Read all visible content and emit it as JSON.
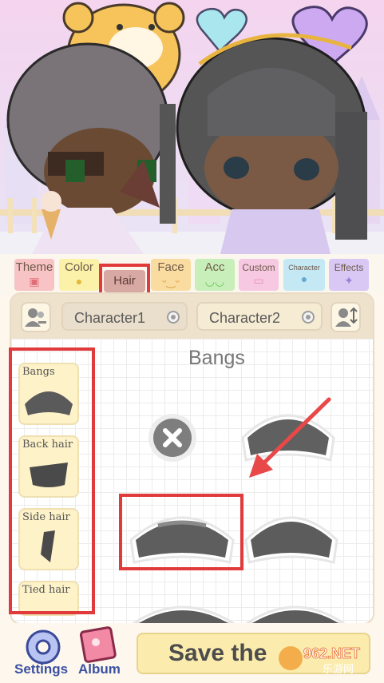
{
  "tabs": [
    {
      "label": "Theme",
      "icon": "scene-icon",
      "color": "#f7c3c4"
    },
    {
      "label": "Color",
      "icon": "drop-icon",
      "color": "#fbf1a8"
    },
    {
      "label": "Hair",
      "icon": "hair-icon",
      "color": "#d8a9a2",
      "selected": true
    },
    {
      "label": "Face",
      "icon": "face-icon",
      "color": "#fbdca0"
    },
    {
      "label": "Acc",
      "icon": "glasses-icon",
      "color": "#c8efb9"
    },
    {
      "label": "Custom",
      "icon": "image-icon",
      "color": "#f7c8e2"
    },
    {
      "label": "Character",
      "icon": "person-icon",
      "color": "#c4e8f4"
    },
    {
      "label": "Effects",
      "icon": "sparkle-icon",
      "color": "#d9c8f4"
    }
  ],
  "characters": {
    "first": "Character1",
    "second": "Character2"
  },
  "side_categories": [
    {
      "label": "Bangs"
    },
    {
      "label": "Back hair"
    },
    {
      "label": "Side hair"
    },
    {
      "label": "Tied hair"
    }
  ],
  "section_title": "Bangs",
  "bottom": {
    "settings_label": "Settings",
    "album_label": "Album",
    "save_label": "Save the"
  },
  "watermark": "962.NET 乐游网",
  "colors": {
    "highlight": "#e03a3a",
    "arrow": "#e84848",
    "accent": "#fbecae"
  }
}
